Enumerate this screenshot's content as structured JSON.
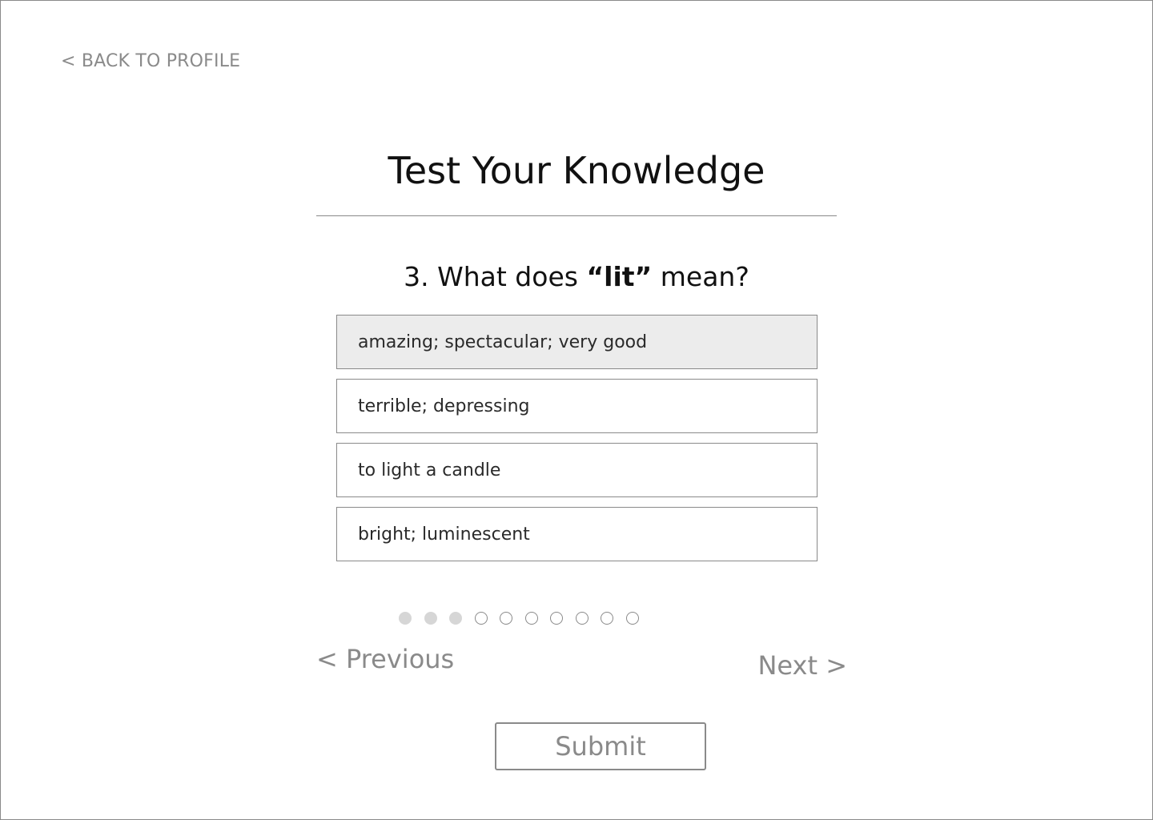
{
  "header": {
    "back_label": "< BACK TO PROFILE",
    "title": "Test Your Knowledge"
  },
  "question": {
    "prefix": "3. What does ",
    "open_quote": "“",
    "term": "lit",
    "close_quote": "”",
    "suffix": " mean?"
  },
  "answers": [
    {
      "label": "amazing; spectacular; very good",
      "selected": true
    },
    {
      "label": "terrible; depressing",
      "selected": false
    },
    {
      "label": "to light a candle",
      "selected": false
    },
    {
      "label": "bright; luminescent",
      "selected": false
    }
  ],
  "progress": {
    "total_questions": 10,
    "completed": 3
  },
  "navigation": {
    "previous_label": "< Previous",
    "next_label": "Next >",
    "submit_label": "Submit"
  },
  "colors": {
    "muted_text": "#8a8a8a",
    "selected_answer_bg": "#ececec",
    "completed_dot": "#d6d6d6"
  }
}
